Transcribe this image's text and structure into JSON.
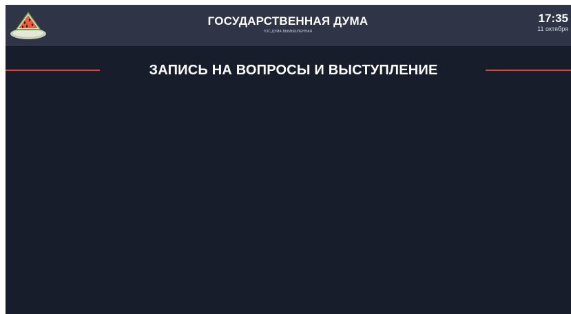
{
  "header": {
    "logo_icon": "watermelon-icon",
    "title": "ГОСУДАРСТВЕННАЯ ДУМА",
    "subtitle": "ГОС.ДУМА ВЫМЫШЛЕННАЯ"
  },
  "clock": {
    "time": "17:35",
    "date": "11 октября"
  },
  "section": {
    "title": "ЗАПИСЬ НА ВОПРОСЫ И ВЫСТУПЛЕНИЕ"
  },
  "colors": {
    "background": "#181d2b",
    "header": "#2f3547",
    "accent": "#d8453c"
  }
}
